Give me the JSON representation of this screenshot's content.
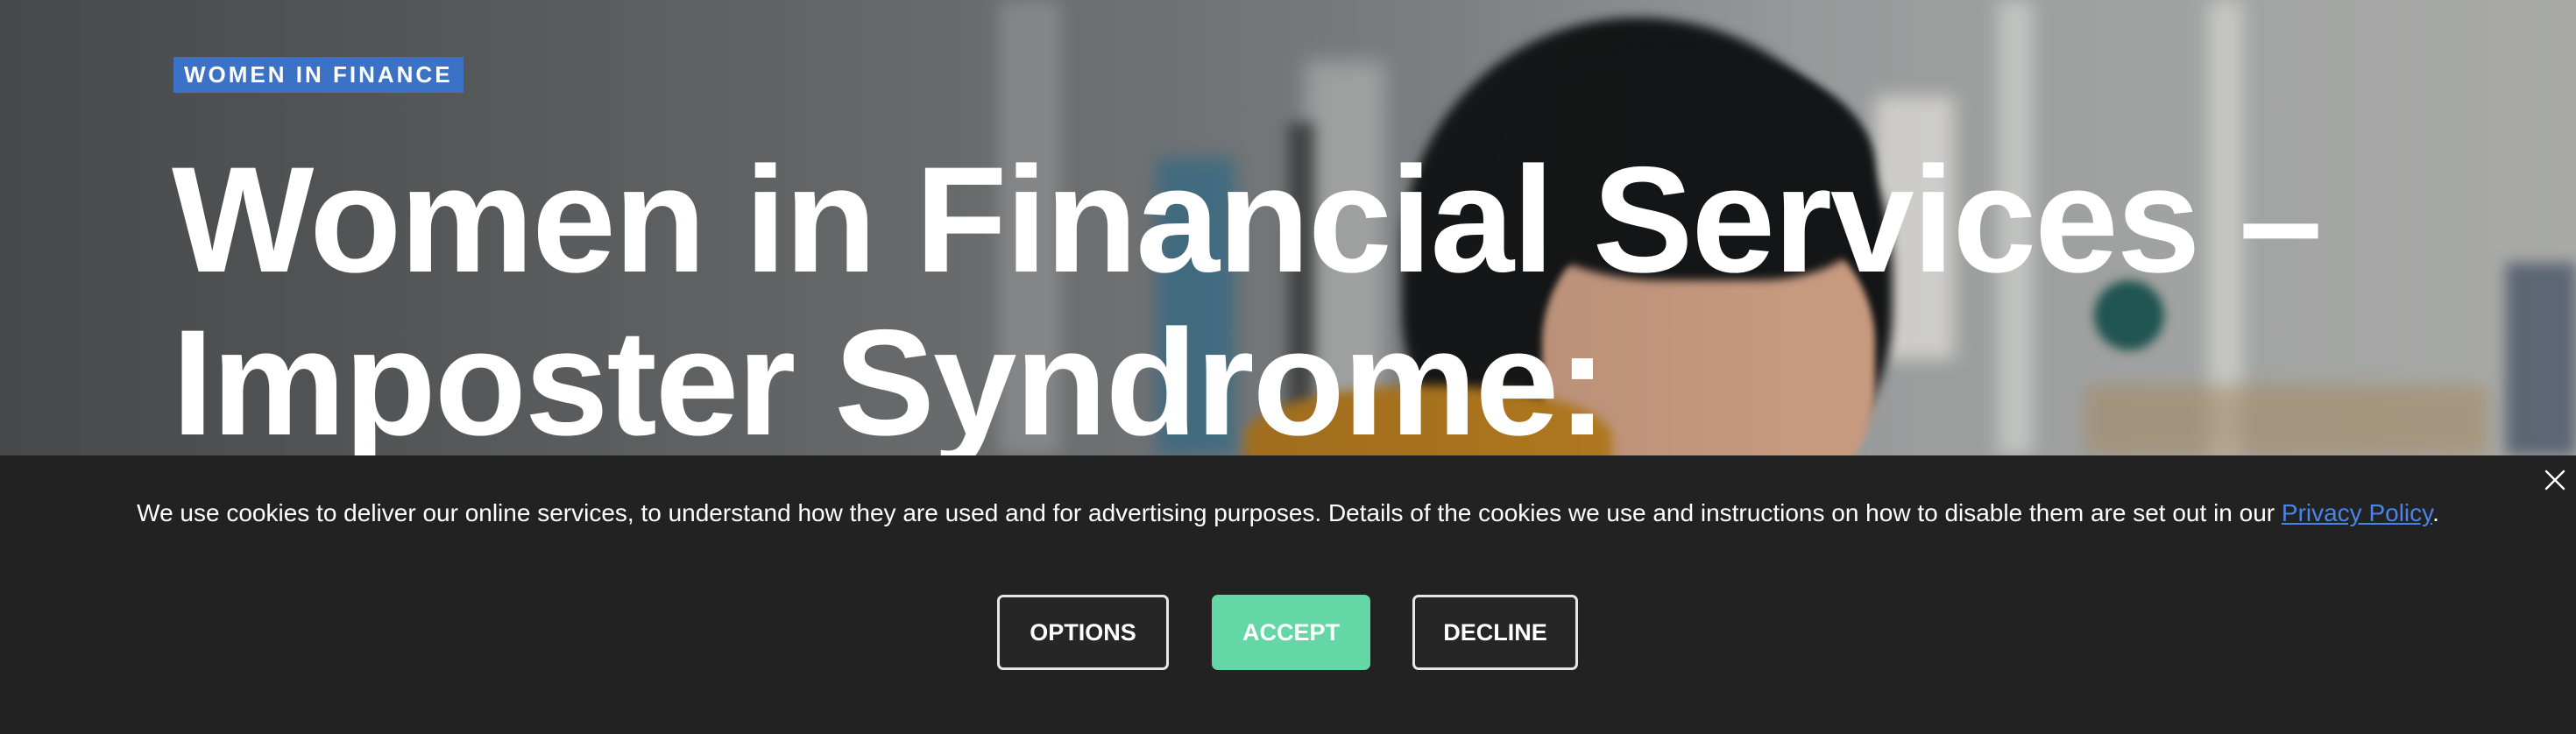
{
  "hero": {
    "tag": "WOMEN IN FINANCE",
    "title_line1": "Women in Financial Services –",
    "title_line2": "Imposter Syndrome:"
  },
  "cookie_banner": {
    "message": "We use cookies to deliver our online services, to understand how they are used and for advertising purposes. Details of the cookies we use and instructions on how to disable them are set out in our ",
    "privacy_link": "Privacy Policy",
    "message_end": ".",
    "close_icon": "close-icon",
    "buttons": {
      "options": "OPTIONS",
      "accept": "ACCEPT",
      "decline": "DECLINE"
    }
  },
  "colors": {
    "tag_bg": "#3b72c6",
    "accept_bg": "#63d7a6",
    "banner_bg": "#222222",
    "link": "#4a84e8"
  }
}
